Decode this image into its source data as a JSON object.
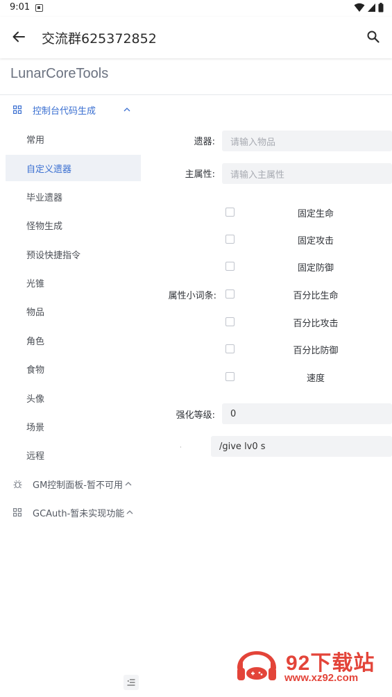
{
  "status_bar": {
    "time": "9:01"
  },
  "app_bar": {
    "title": "交流群625372852"
  },
  "brand": "LunarCoreTools",
  "sidebar": {
    "group_console": {
      "label": "控制台代码生成"
    },
    "items": [
      {
        "label": "常用"
      },
      {
        "label": "自定义遗器",
        "active": true
      },
      {
        "label": "毕业遗器"
      },
      {
        "label": "怪物生成"
      },
      {
        "label": "预设快捷指令"
      },
      {
        "label": "光锥"
      },
      {
        "label": "物品"
      },
      {
        "label": "角色"
      },
      {
        "label": "食物"
      },
      {
        "label": "头像"
      },
      {
        "label": "场景"
      },
      {
        "label": "远程"
      }
    ],
    "group_gm": {
      "label": "GM控制面板-暂不可用"
    },
    "group_gcauth": {
      "label": "GCAuth-暂未实现功能"
    }
  },
  "form": {
    "relic_label": "遗器:",
    "relic_placeholder": "请输入物品",
    "main_stat_label": "主属性:",
    "main_stat_placeholder": "请输入主属性",
    "substats_label": "属性小词条:",
    "substats": [
      {
        "label": "固定生命",
        "checked": false
      },
      {
        "label": "固定攻击",
        "checked": false
      },
      {
        "label": "固定防御",
        "checked": false
      },
      {
        "label": "百分比生命",
        "checked": false
      },
      {
        "label": "百分比攻击",
        "checked": false
      },
      {
        "label": "百分比防御",
        "checked": false
      },
      {
        "label": "速度",
        "checked": false
      }
    ],
    "level_label": "强化等级:",
    "level_value": "0",
    "command_output": "/give  lv0 s"
  },
  "watermark": {
    "name": "92下载站",
    "url": "www.xz92.com"
  },
  "colors": {
    "accent": "#3a6fd1",
    "input_bg": "#f2f3f5",
    "active_bg": "#eef1f6",
    "watermark": "#e23a2f"
  }
}
